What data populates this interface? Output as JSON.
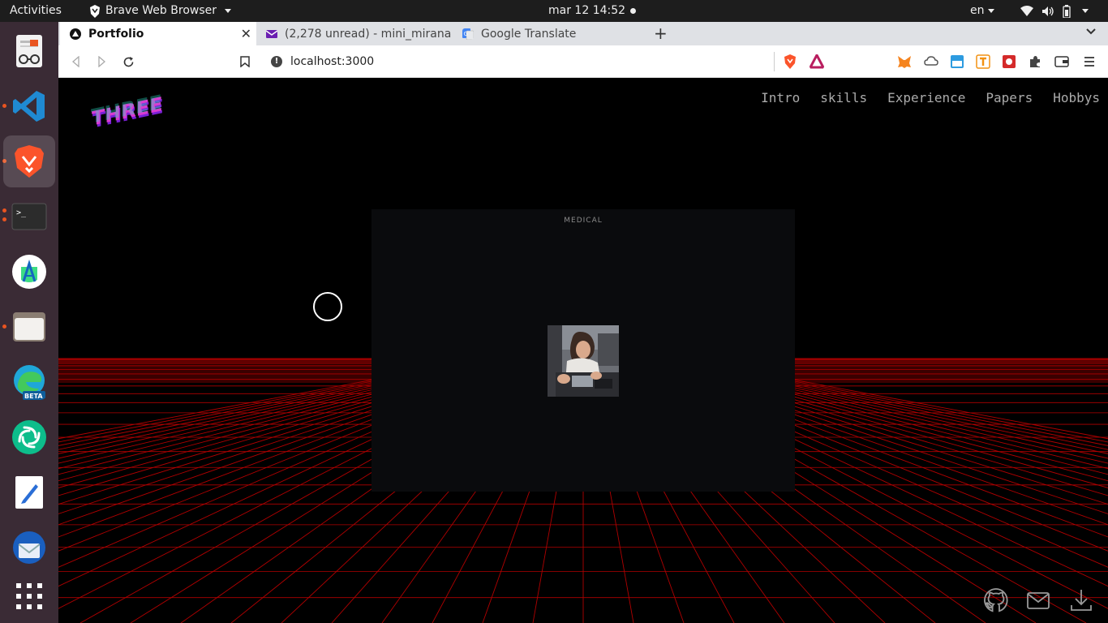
{
  "system": {
    "activities_label": "Activities",
    "app_menu_label": "Brave Web Browser",
    "clock": "mar 12  14:52",
    "language": "en"
  },
  "dock": {
    "items": [
      {
        "name": "document-viewer"
      },
      {
        "name": "vscode"
      },
      {
        "name": "brave"
      },
      {
        "name": "terminal"
      },
      {
        "name": "android-studio"
      },
      {
        "name": "files"
      },
      {
        "name": "edge-beta",
        "badge": "BETA"
      },
      {
        "name": "element"
      },
      {
        "name": "text-editor"
      },
      {
        "name": "thunderbird"
      },
      {
        "name": "show-apps"
      }
    ],
    "accent_color": "#e95420"
  },
  "browser": {
    "tabs": [
      {
        "label": "Portfolio",
        "active": true
      },
      {
        "label": "(2,278 unread) - mini_mirana@",
        "active": false
      },
      {
        "label": "Google Translate",
        "active": false
      }
    ],
    "url": "localhost:3000"
  },
  "page": {
    "logo_text": "THREE",
    "nav": [
      "Intro",
      "skills",
      "Experience",
      "Papers",
      "Hobbys"
    ],
    "card": {
      "title": "MEDICAL",
      "photo_alt": "person working at a table"
    },
    "grid_color": "#b00000",
    "footer_icons": [
      "github-icon",
      "mail-icon",
      "download-icon"
    ]
  }
}
